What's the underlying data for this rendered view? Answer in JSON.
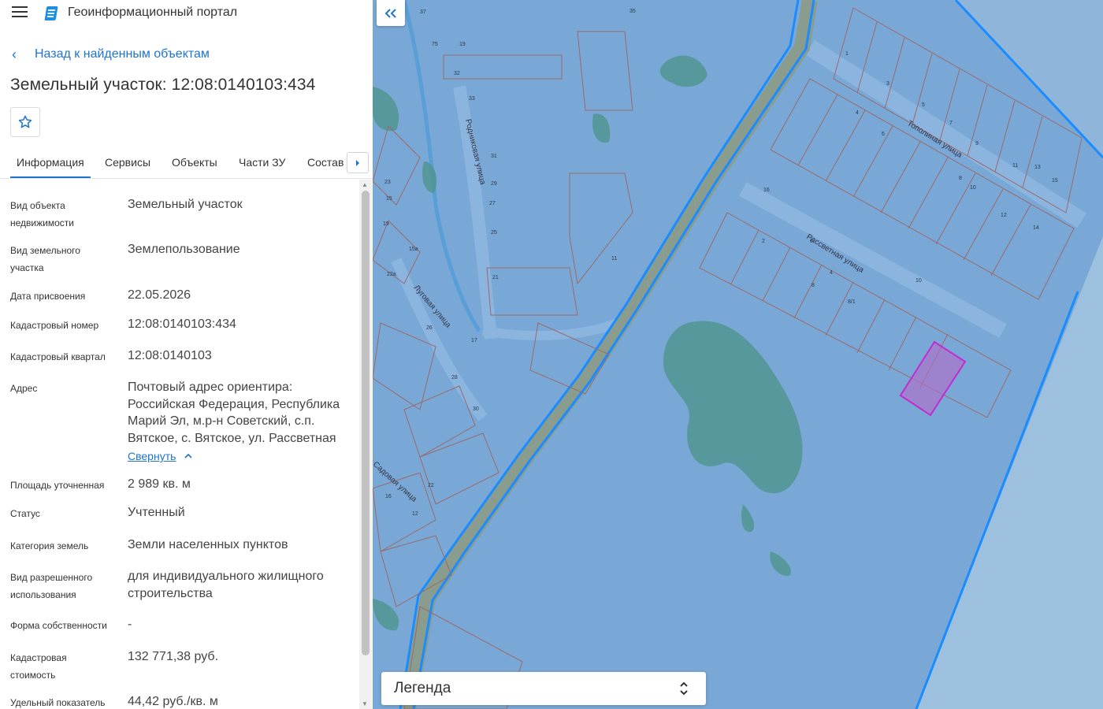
{
  "app": {
    "title": "Геоинформационный портал",
    "icons": {
      "menu": "menu-icon",
      "logo": "portal-logo"
    },
    "colors": {
      "accent": "#1e74d0",
      "map_background": "#7aa7d4",
      "selected_parcel": "#b43cc8"
    }
  },
  "nav": {
    "back_label": "Назад к найденным объектам"
  },
  "object": {
    "title": "Земельный участок: 12:08:0140103:434",
    "favorite_icon": "star-icon"
  },
  "tabs": [
    {
      "label": "Информация",
      "active": true
    },
    {
      "label": "Сервисы",
      "active": false
    },
    {
      "label": "Объекты",
      "active": false
    },
    {
      "label": "Части ЗУ",
      "active": false
    },
    {
      "label": "Состав",
      "active": false
    }
  ],
  "info": {
    "rows": [
      {
        "label": "Вид объекта недвижимости",
        "value": "Земельный участок"
      },
      {
        "label": "Вид земельного участка",
        "value": "Землепользование"
      },
      {
        "label": "Дата присвоения",
        "value": "22.05.2026"
      },
      {
        "label": "Кадастровый номер",
        "value": "12:08:0140103:434"
      },
      {
        "label": "Кадастровый квартал",
        "value": "12:08:0140103"
      },
      {
        "label": "Адрес",
        "value": "Почтовый адрес ориентира: Российская Федерация, Республика Марий Эл, м.р-н Советский, с.п. Вятское, с. Вятское, ул. Рассветная"
      },
      {
        "label": "Площадь уточненная",
        "value": "2 989 кв. м"
      },
      {
        "label": "Статус",
        "value": "Учтенный"
      },
      {
        "label": "Категория земель",
        "value": "Земли населенных пунктов"
      },
      {
        "label": "Вид разрешенного использования",
        "value": "для индивидуального жилищного строительства"
      },
      {
        "label": "Форма собственности",
        "value": "-"
      },
      {
        "label": "Кадастровая стоимость",
        "value": "132 771,38 руб."
      },
      {
        "label": "Удельный показатель",
        "value": "44,42 руб./кв. м"
      }
    ],
    "collapse_label": "Свернуть"
  },
  "map": {
    "street_labels": [
      "Родниковая улица",
      "Луговая улица",
      "Тополиная улица",
      "Рассветная улица",
      "Садовая улица"
    ],
    "lot_numbers": [
      "32",
      "33",
      "31",
      "29",
      "27",
      "25",
      "21",
      "23",
      "19",
      "15",
      "15а",
      "22а",
      "26",
      "28",
      "30",
      "17",
      "22",
      "16",
      "12",
      "1",
      "3",
      "5",
      "7",
      "9",
      "11",
      "13",
      "15",
      "4",
      "6",
      "8",
      "10",
      "12",
      "14",
      "16",
      "2",
      "4",
      "6",
      "8",
      "8/1",
      "10",
      "11",
      "19",
      "75",
      "37",
      "35",
      "26",
      "63б"
    ],
    "legend_label": "Легенда"
  }
}
